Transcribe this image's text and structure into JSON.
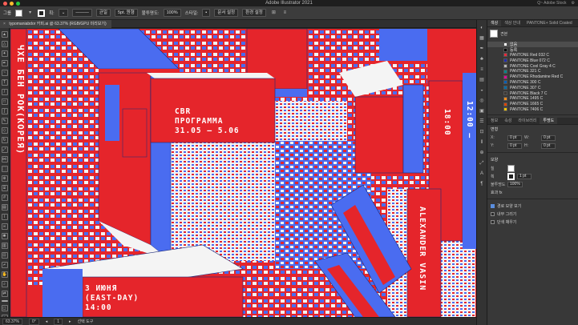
{
  "app": {
    "window_title": "Adobe Illustrator 2021",
    "traffic_colors": [
      "#ff5f57",
      "#febc2e",
      "#28c840"
    ],
    "right_status": [
      "Q~ Adobe Stock",
      "⚙"
    ]
  },
  "control_bar": {
    "group_label": "그룹",
    "stroke_label": "획:",
    "brush_value": "균일",
    "basic_value": "5pt. 원형",
    "style_label": "불투명도:",
    "opacity_value": "100%",
    "style2": "스타일:",
    "align_label": "문서 설정",
    "prefs_label": "환경 설정"
  },
  "document": {
    "tab_title": "typomaniabdor 카피.ai @ 63.37% (RGB/GPU 미리보기)"
  },
  "artwork": {
    "vertical_left": "ЧХЕ БЕН РОК(КОРЕЯ)",
    "title_line1": "CBR",
    "title_line2": "ПРОГРАММА",
    "title_line3": "31.05 — 5.06",
    "time_right": "12:00 —",
    "time_right2": "18:00",
    "bottom_line1": "3 ИЮНЯ",
    "bottom_line2": "(EAST-DAY)",
    "bottom_line3": "14:00",
    "vertical_right": "ALEXANDER VASIN",
    "colors": {
      "red": "#e5252b",
      "blue": "#4a6cf0",
      "white": "#f4f4f4",
      "navy": "#1d2a78"
    }
  },
  "status_bar": {
    "zoom": "63.37%",
    "rotation": "0°",
    "artboard": "1",
    "tool": "선택 도구"
  },
  "panel": {
    "tabs": [
      "색상",
      "색상 안내",
      "PANTONE+ Solid Coated"
    ],
    "swatch_header": "견본",
    "swatches": [
      {
        "name": "없음",
        "color": "#ffffff"
      },
      {
        "name": "등록",
        "color": "#000000"
      },
      {
        "name": "PANTONE Red 032 C",
        "color": "#e8283a"
      },
      {
        "name": "PANTONE Blue 072 C",
        "color": "#1f2cb0"
      },
      {
        "name": "PANTONE Cool Gray 4 C",
        "color": "#b7b6b5"
      },
      {
        "name": "PANTONE 321 C",
        "color": "#00878b"
      },
      {
        "name": "PANTONE Rhodamine Red C",
        "color": "#e10098"
      },
      {
        "name": "PANTONE 300 C",
        "color": "#005eb8"
      },
      {
        "name": "PANTONE 307 C",
        "color": "#006ba6"
      },
      {
        "name": "PANTONE Black 7 C",
        "color": "#3d3935"
      },
      {
        "name": "PANTONE 1495 C",
        "color": "#ff8f1c"
      },
      {
        "name": "PANTONE 1665 C",
        "color": "#dc4405"
      },
      {
        "name": "PANTONE 7406 C",
        "color": "#f1c400"
      }
    ],
    "prop_tabs": [
      "정보",
      "속성",
      "라이브러리",
      "투명도"
    ],
    "transform_label": "변형",
    "x_value": "0 pt",
    "y_value": "0 pt",
    "w_value": "0 pt",
    "h_value": "0 pt",
    "appearance_label": "모양",
    "fill_label": "칠",
    "stroke_label": "획",
    "stroke_value": "1 pt",
    "opacity_label": "불투명도",
    "opacity_value": "100%",
    "effects_label": "효과 fx",
    "option_a": "경로 모양 보기",
    "option_b": "내부 그리기",
    "option_c": "단색 채우기"
  }
}
